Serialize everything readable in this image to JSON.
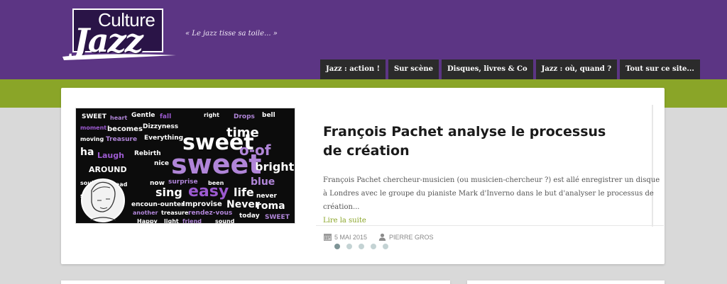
{
  "site": {
    "logo_text_top": "Culture",
    "logo_text_bottom": "Jazz",
    "tagline": "« Le jazz tisse sa toile... »",
    "colors": {
      "header": "#5c3584",
      "accent_green": "#8aa528",
      "nav": "#2b2b2b"
    }
  },
  "nav": {
    "items": [
      {
        "label": "Jazz : action !"
      },
      {
        "label": "Sur scène"
      },
      {
        "label": "Disques, livres & Co"
      },
      {
        "label": "Jazz : où, quand ?"
      },
      {
        "label": "Tout sur ce site..."
      }
    ]
  },
  "slide": {
    "image_icon": "word-cloud-image",
    "title": "François Pachet analyse le processus de création",
    "excerpt": "François Pachet chercheur-musicien (ou musicien-chercheur ?) est allé enregistrer un disque à Londres avec le groupe du pianiste Mark d'Inverno dans le but d'analyser le processus de création...",
    "read_more": "Lire la suite",
    "date_icon": "calendar-icon",
    "date": "5 MAI 2015",
    "author_icon": "user-icon",
    "author": "PIERRE GROS"
  },
  "slider": {
    "dot_count": 5,
    "active_dot": 1
  }
}
